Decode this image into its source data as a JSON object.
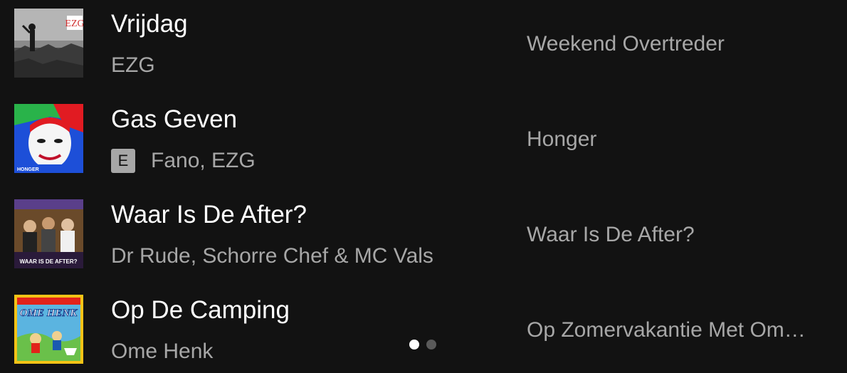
{
  "tracks": [
    {
      "title": "Vrijdag",
      "artist": "EZG",
      "explicit": false,
      "album": "Weekend Overtreder",
      "cover_text": "EZG"
    },
    {
      "title": "Gas Geven",
      "artist": "Fano, EZG",
      "explicit": true,
      "explicit_label": "E",
      "album": "Honger",
      "cover_text": "HONGER"
    },
    {
      "title": "Waar Is De After?",
      "artist": "Dr Rude, Schorre Chef & MC Vals",
      "explicit": false,
      "album": "Waar Is De After?",
      "cover_text": "WAAR IS DE AFTER?"
    },
    {
      "title": "Op De Camping",
      "artist": "Ome Henk",
      "explicit": false,
      "album": "Op Zomervakantie Met Om…",
      "cover_text": "OME HENK"
    }
  ],
  "pager": {
    "pages": 2,
    "active": 1
  },
  "colors": {
    "background": "#121212",
    "primary_text": "#ffffff",
    "secondary_text": "#a7a7a7",
    "badge": "#a7a7a7"
  }
}
